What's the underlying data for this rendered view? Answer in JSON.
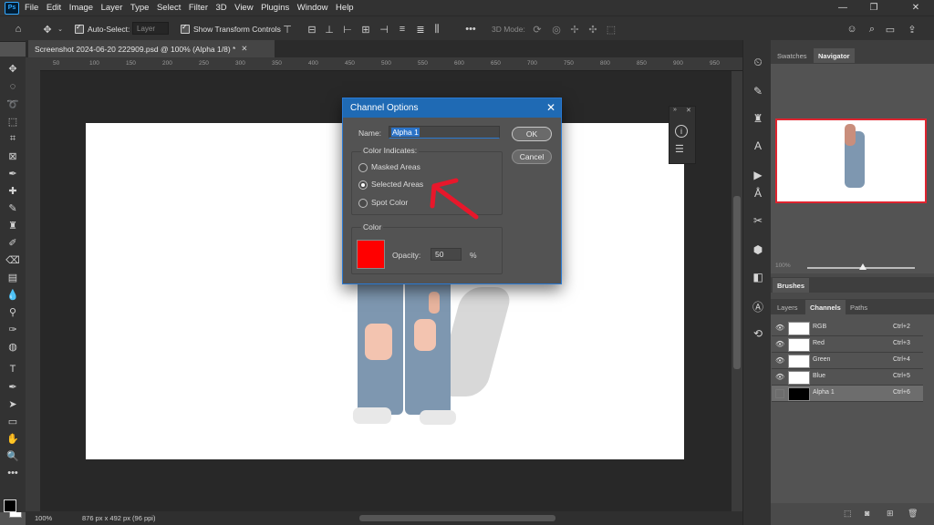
{
  "app": {
    "logo": "Ps"
  },
  "menu": [
    "File",
    "Edit",
    "Image",
    "Layer",
    "Type",
    "Select",
    "Filter",
    "3D",
    "View",
    "Plugins",
    "Window",
    "Help"
  ],
  "window_controls": [
    "—",
    "❐",
    "✕"
  ],
  "options_bar": {
    "auto_select_label": "Auto-Select:",
    "auto_select_value": "Layer",
    "show_transform_label": "Show Transform Controls",
    "mode_3d_label": "3D Mode:"
  },
  "document": {
    "tab_title": "Screenshot 2024-06-20 222909.psd @ 100% (Alpha 1/8) *",
    "ruler_ticks": [
      "50",
      "100",
      "150",
      "200",
      "250",
      "300",
      "350",
      "400",
      "450",
      "500",
      "550",
      "600",
      "650",
      "700",
      "750",
      "800",
      "850",
      "900",
      "950"
    ],
    "zoom": "100%",
    "info": "876 px x 492 px (96 ppi)"
  },
  "dialog": {
    "title": "Channel Options",
    "name_label": "Name:",
    "name_value": "Alpha 1",
    "ok_label": "OK",
    "cancel_label": "Cancel",
    "indicates_label": "Color Indicates:",
    "options": [
      {
        "label": "Masked Areas",
        "checked": false
      },
      {
        "label": "Selected Areas",
        "checked": true
      },
      {
        "label": "Spot Color",
        "checked": false
      }
    ],
    "color_group_label": "Color",
    "swatch_color": "#ff0000",
    "opacity_label": "Opacity:",
    "opacity_value": "50",
    "opacity_unit": "%"
  },
  "right_panels": {
    "top_tabs": [
      "Swatches",
      "Navigator"
    ],
    "navigator_zoom": "100%",
    "brushes_label": "Brushes",
    "layer_tabs": [
      "Layers",
      "Channels",
      "Paths"
    ],
    "channels": [
      {
        "name": "RGB",
        "shortcut": "Ctrl+2",
        "visible": true
      },
      {
        "name": "Red",
        "shortcut": "Ctrl+3",
        "visible": true
      },
      {
        "name": "Green",
        "shortcut": "Ctrl+4",
        "visible": true
      },
      {
        "name": "Blue",
        "shortcut": "Ctrl+5",
        "visible": true
      },
      {
        "name": "Alpha 1",
        "shortcut": "Ctrl+6",
        "visible": false
      }
    ]
  },
  "colors": {
    "accent": "#1f6ab4",
    "annotation": "#e8172b",
    "panel": "#535353"
  }
}
